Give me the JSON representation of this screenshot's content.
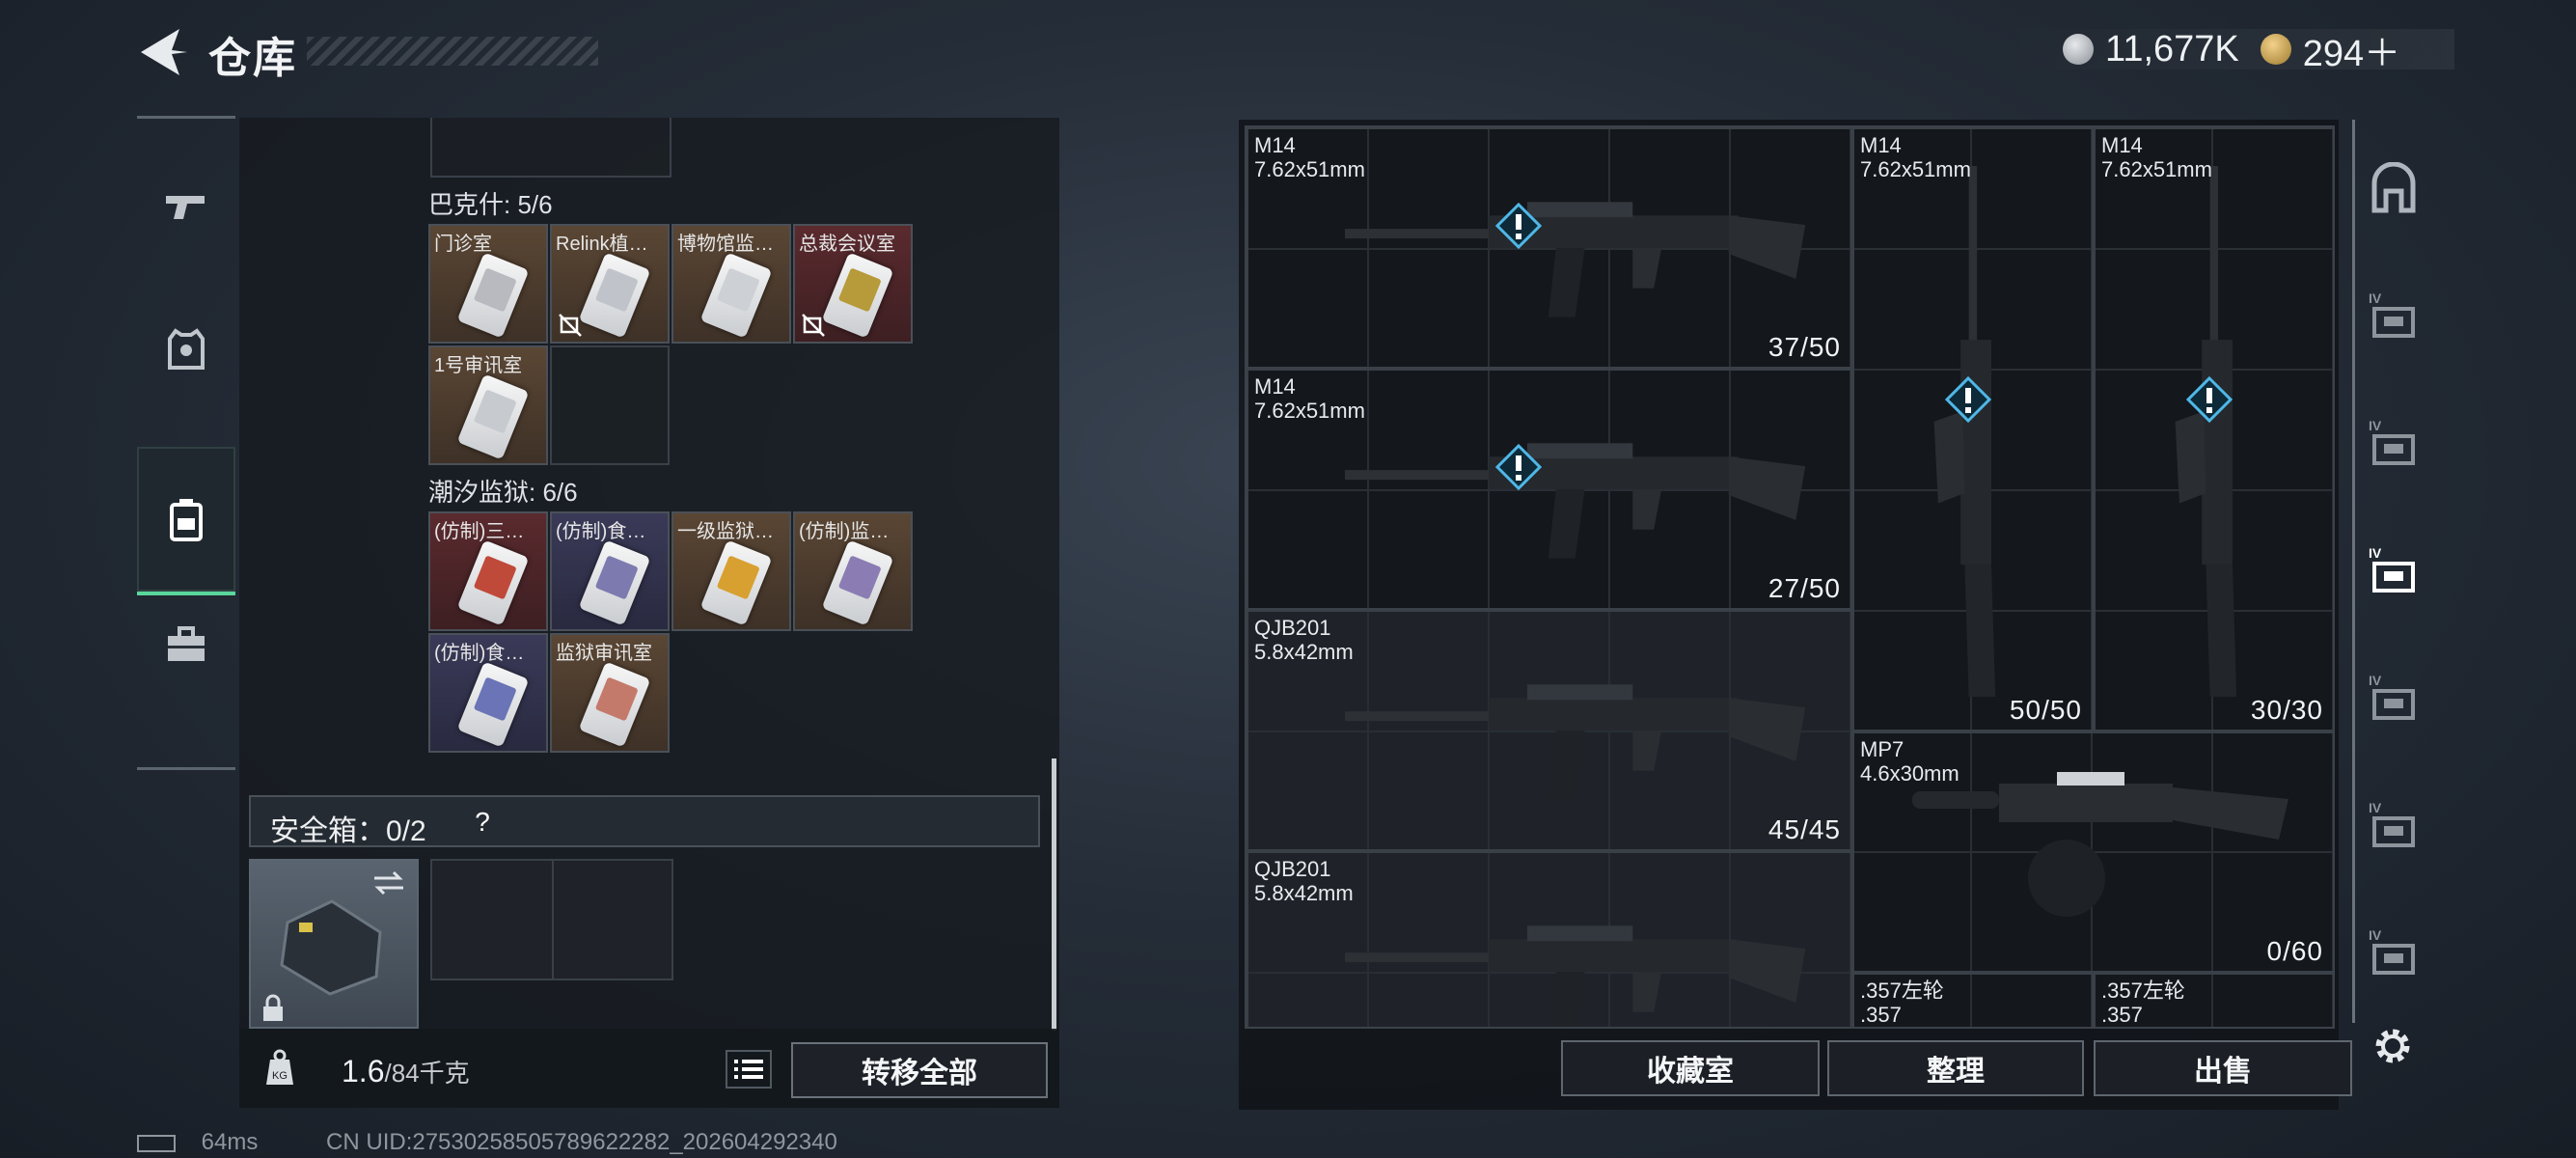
{
  "header": {
    "title": "仓库",
    "currency": [
      {
        "icon": "silver-coin-icon",
        "value": "11,677K"
      },
      {
        "icon": "gold-coin-icon",
        "value": "294＋"
      }
    ]
  },
  "left_nav": [
    {
      "icon": "pistol-icon"
    },
    {
      "icon": "vest-icon"
    },
    {
      "icon": "backpack-icon",
      "active": true
    },
    {
      "icon": "toolbox-icon"
    }
  ],
  "keycard_sections": [
    {
      "label": "巴克什: 5/6",
      "items": [
        {
          "name": "门诊室",
          "bg": "brown",
          "stripe": "#b9b9c0"
        },
        {
          "name": "Relink植…",
          "bg": "brown",
          "stripe": "#c0c4ca",
          "flag": true
        },
        {
          "name": "博物馆监…",
          "bg": "brown",
          "stripe": "#cdd0d4"
        },
        {
          "name": "总裁会议室",
          "bg": "darkred",
          "stripe": "#b79a3a",
          "flag": true
        },
        {
          "name": "1号审讯室",
          "bg": "brown",
          "stripe": "#c7cacf"
        }
      ]
    },
    {
      "label": "潮汐监狱: 6/6",
      "items": [
        {
          "name": "(仿制)三…",
          "bg": "darkred",
          "stripe": "#c04a3a"
        },
        {
          "name": "(仿制)食…",
          "bg": "navy",
          "stripe": "#7d7ab0"
        },
        {
          "name": "一级监狱…",
          "bg": "brown",
          "stripe": "#d8a030"
        },
        {
          "name": "(仿制)监…",
          "bg": "brown",
          "stripe": "#8b7db3"
        },
        {
          "name": "(仿制)食…",
          "bg": "navy",
          "stripe": "#6a74b6"
        },
        {
          "name": "监狱审讯室",
          "bg": "brown",
          "stripe": "#c47a6a"
        }
      ]
    }
  ],
  "safebox": {
    "label": "安全箱：0/2",
    "help": "?"
  },
  "bottom": {
    "weight_current": "1.6",
    "weight_max": "/84千克",
    "transfer_label": "转移全部"
  },
  "weapons": [
    {
      "name": "M14",
      "caliber": "7.62x51mm",
      "ammo": "37/50"
    },
    {
      "name": "M14",
      "caliber": "7.62x51mm",
      "ammo": "27/50"
    },
    {
      "name": "M14",
      "caliber": "7.62x51mm",
      "ammo": "50/50"
    },
    {
      "name": "M14",
      "caliber": "7.62x51mm",
      "ammo": "30/30"
    },
    {
      "name": "QJB201",
      "caliber": "5.8x42mm",
      "ammo": "45/45"
    },
    {
      "name": "MP7",
      "caliber": "4.6x30mm",
      "ammo": "0/60"
    },
    {
      "name": "QJB201",
      "caliber": "5.8x42mm",
      "ammo": ""
    },
    {
      "name": ".357左轮",
      "caliber": ".357",
      "ammo": ""
    },
    {
      "name": ".357左轮",
      "caliber": ".357",
      "ammo": ""
    }
  ],
  "right_nav": [
    {
      "icon": "safe-vault-icon",
      "tier": ""
    },
    {
      "icon": "folder-icon",
      "tier": "IV"
    },
    {
      "icon": "medkit-icon",
      "tier": "IV"
    },
    {
      "icon": "weapon-case-icon",
      "tier": "IV"
    },
    {
      "icon": "ammo-case-icon",
      "tier": "IV"
    },
    {
      "icon": "tool-case-icon",
      "tier": "IV"
    },
    {
      "icon": "misc-case-icon",
      "tier": "IV"
    }
  ],
  "actions": {
    "collection": "收藏室",
    "sort": "整理",
    "sell": "出售"
  },
  "footer": {
    "ping": "64ms",
    "uid": "CN UID:27530258505789622282_202604292340"
  },
  "colors": {
    "accent": "#59d69b",
    "warning": "#4fb8e8"
  }
}
